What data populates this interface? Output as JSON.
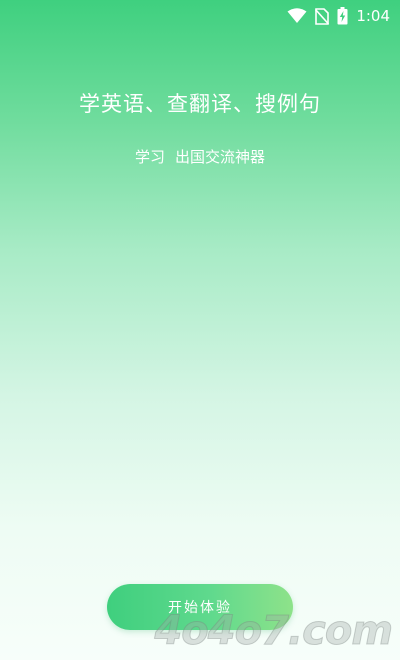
{
  "status_bar": {
    "time": "1:04",
    "icons": [
      "wifi-icon",
      "no-sim-icon",
      "battery-charging-icon"
    ]
  },
  "hero": {
    "headline": "学英语、查翻译、搜例句",
    "subline_left": "学习",
    "subline_right": "出国交流神器"
  },
  "start_button": {
    "label": "开始体验"
  },
  "watermark": {
    "text": "4o4o7.com"
  },
  "colors": {
    "accent_green": "#3fd07f",
    "button_green_end": "#8ee28a",
    "text_white": "#ffffff"
  }
}
